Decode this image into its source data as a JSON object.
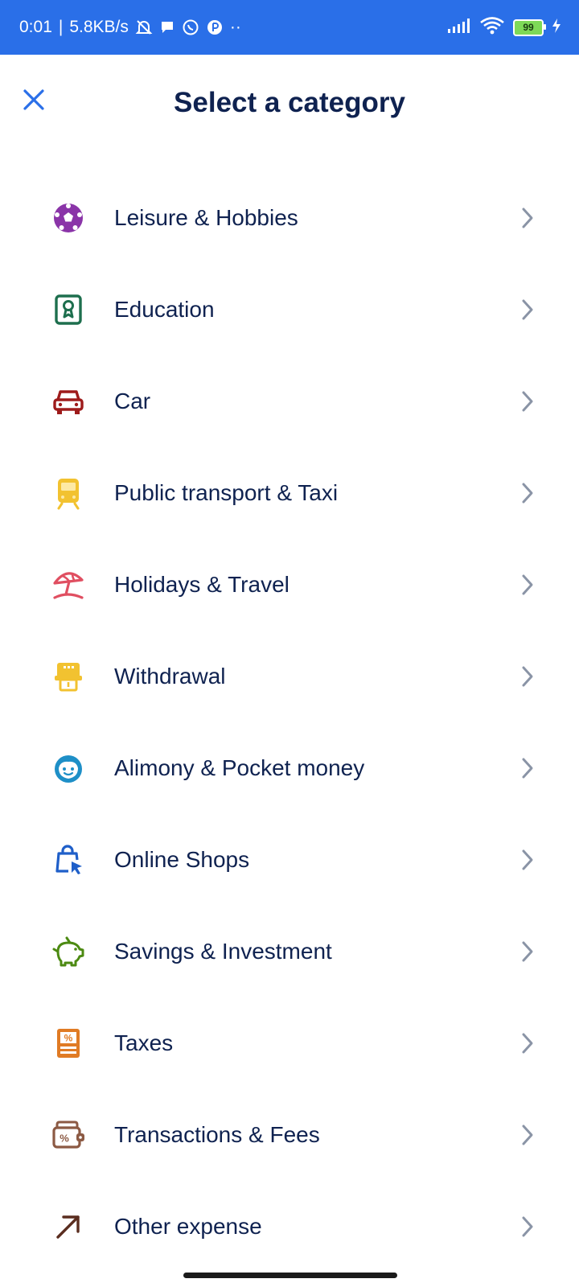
{
  "status_bar": {
    "time": "0:01",
    "separator": "|",
    "net_speed": "5.8KB/s",
    "left_icons": [
      "mute-bell-icon",
      "chat-bubble-icon",
      "whatsapp-icon",
      "app-icon"
    ],
    "more": "··",
    "right_icons": [
      "signal-icon",
      "wifi-icon"
    ],
    "battery_level": "99",
    "charging": true,
    "color": "#2a6fe8"
  },
  "header": {
    "title": "Select a category",
    "close_icon": "close-icon"
  },
  "categories": [
    {
      "label": "Leisure & Hobbies",
      "icon": "soccer-ball-icon",
      "color": "#8a34a8"
    },
    {
      "label": "Education",
      "icon": "certificate-icon",
      "color": "#1e6f4e"
    },
    {
      "label": "Car",
      "icon": "car-icon",
      "color": "#9e1b1b"
    },
    {
      "label": "Public transport & Taxi",
      "icon": "tram-icon",
      "color": "#f2c230"
    },
    {
      "label": "Holidays & Travel",
      "icon": "beach-umbrella-icon",
      "color": "#e04f61"
    },
    {
      "label": "Withdrawal",
      "icon": "atm-icon",
      "color": "#f2c230"
    },
    {
      "label": "Alimony & Pocket money",
      "icon": "child-face-icon",
      "color": "#1e8fc7"
    },
    {
      "label": "Online Shops",
      "icon": "shopping-bag-cursor-icon",
      "color": "#1f5fc9"
    },
    {
      "label": "Savings & Investment",
      "icon": "piggy-bank-icon",
      "color": "#4c8a12"
    },
    {
      "label": "Taxes",
      "icon": "tax-document-icon",
      "color": "#e07b24"
    },
    {
      "label": "Transactions & Fees",
      "icon": "wallet-percent-icon",
      "color": "#8c5a44"
    },
    {
      "label": "Other expense",
      "icon": "arrow-up-right-icon",
      "color": "#5a2d1f"
    }
  ],
  "colors": {
    "text": "#0f2250",
    "accent": "#2a6fe8",
    "chevron": "#8a94a6"
  }
}
